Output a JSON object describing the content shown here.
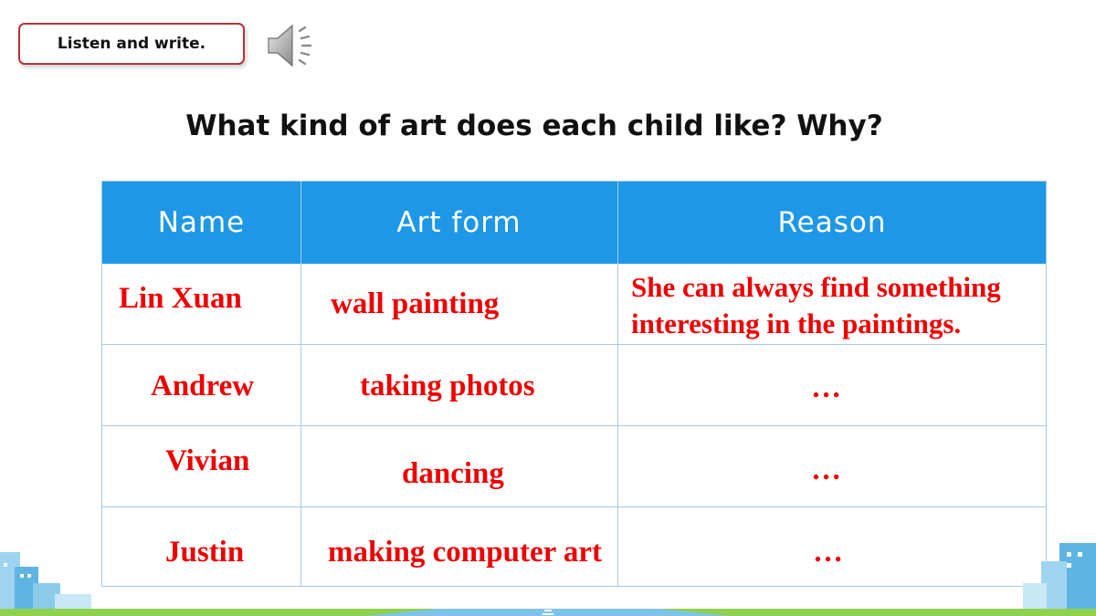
{
  "instruction": "Listen and write.",
  "question": "What kind of art does each child like? Why?",
  "table": {
    "headers": [
      "Name",
      "Art form",
      "Reason"
    ],
    "rows": [
      {
        "name": "Lin Xuan",
        "art_form": "wall painting",
        "reason_line1": "She can always find something",
        "reason_line2": "interesting in the paintings."
      },
      {
        "name": "Andrew",
        "art_form": "taking photos",
        "reason": "…"
      },
      {
        "name": "Vivian",
        "art_form": "dancing",
        "reason": "…"
      },
      {
        "name": "Justin",
        "art_form": "making computer art",
        "reason": "…"
      }
    ]
  },
  "icons": {
    "speaker": "speaker-icon"
  },
  "colors": {
    "header_bg": "#1e97e6",
    "answer_text": "#ee0000",
    "instruction_border": "#b3343a"
  }
}
